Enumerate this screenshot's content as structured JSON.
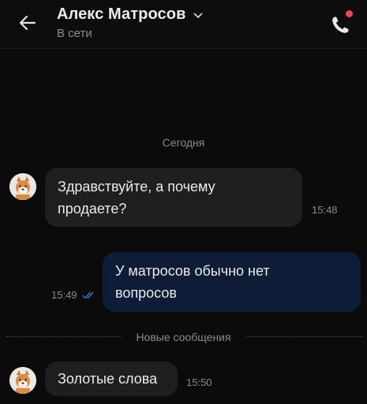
{
  "header": {
    "contact_name": "Алекс Матросов",
    "status": "В сети",
    "notification_dot_color": "#e74b4b"
  },
  "chat": {
    "date_separator": "Сегодня",
    "new_messages_separator": "Новые сообщения",
    "messages": [
      {
        "direction": "incoming",
        "lines": [
          "Здравствуйте, а почему",
          "продаете?"
        ],
        "time": "15:48"
      },
      {
        "direction": "outgoing",
        "lines": [
          "У матросов обычно нет",
          "вопросов"
        ],
        "time": "15:49",
        "read": true
      },
      {
        "direction": "incoming",
        "lines": [
          "Золотые слова"
        ],
        "time": "15:50"
      }
    ]
  },
  "colors": {
    "background": "#0b0b0b",
    "incoming_bubble": "#1f1f21",
    "outgoing_bubble": "#0f1c37",
    "read_ticks": "#3d73d9"
  }
}
